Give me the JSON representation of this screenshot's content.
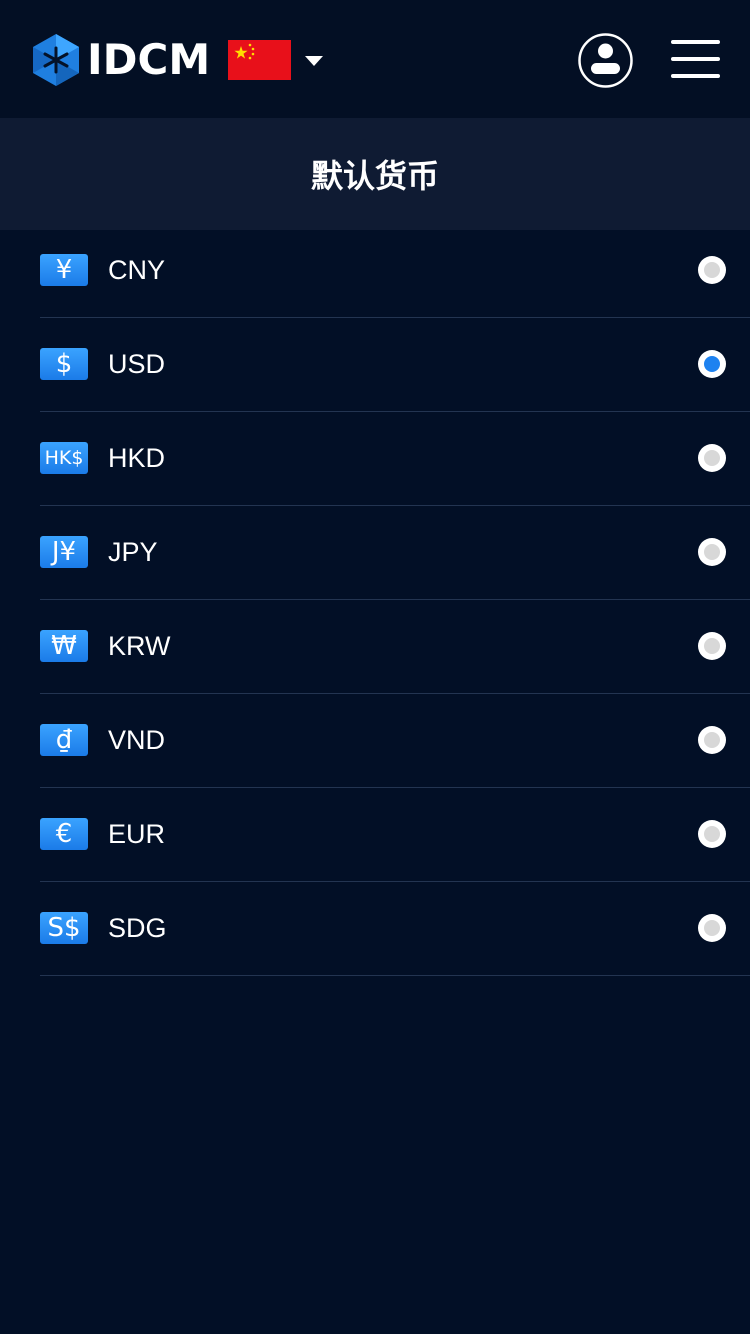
{
  "header": {
    "brand": "IDCM",
    "language_flag": "china-flag-icon",
    "user_icon": "user-icon",
    "menu_icon": "hamburger-menu-icon"
  },
  "page": {
    "title": "默认货币"
  },
  "currencies": [
    {
      "symbol": "¥",
      "code": "CNY",
      "selected": false
    },
    {
      "symbol": "$",
      "code": "USD",
      "selected": true
    },
    {
      "symbol": "HK$",
      "code": "HKD",
      "selected": false
    },
    {
      "symbol": "J¥",
      "code": "JPY",
      "selected": false
    },
    {
      "symbol": "₩",
      "code": "KRW",
      "selected": false
    },
    {
      "symbol": "₫",
      "code": "VND",
      "selected": false
    },
    {
      "symbol": "€",
      "code": "EUR",
      "selected": false
    },
    {
      "symbol": "S$",
      "code": "SDG",
      "selected": false
    }
  ],
  "colors": {
    "background": "#020f26",
    "title_bar": "#0f1b33",
    "accent": "#1e82f0"
  }
}
